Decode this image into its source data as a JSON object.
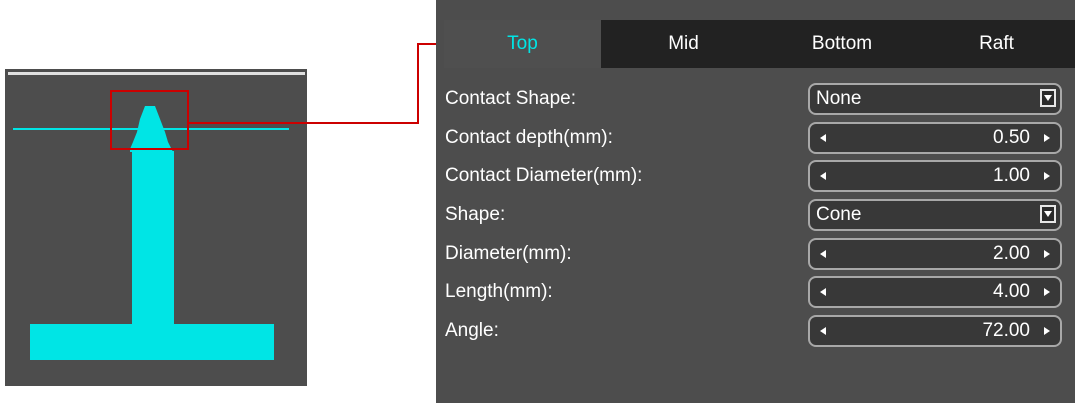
{
  "colors": {
    "panel_bg": "#4d4d4d",
    "tabbar_bg": "#222222",
    "active_tab_text": "#00e5e5",
    "support_fill": "#00e5e5",
    "callout_red": "#cc0000"
  },
  "tabs": [
    {
      "label": "Top",
      "active": true
    },
    {
      "label": "Mid",
      "active": false
    },
    {
      "label": "Bottom",
      "active": false
    },
    {
      "label": "Raft",
      "active": false
    }
  ],
  "settings": [
    {
      "label": "Contact Shape:",
      "control": "combo",
      "value": "None",
      "icon": "dropdown-arrow-icon"
    },
    {
      "label": "Contact depth(mm):",
      "control": "spinner",
      "value": "0.50"
    },
    {
      "label": "Contact Diameter(mm):",
      "control": "spinner",
      "value": "1.00"
    },
    {
      "label": "Shape:",
      "control": "combo",
      "value": "Cone",
      "icon": "dropdown-arrow-icon"
    },
    {
      "label": "Diameter(mm):",
      "control": "spinner",
      "value": "2.00"
    },
    {
      "label": "Length(mm):",
      "control": "spinner",
      "value": "4.00"
    },
    {
      "label": "Angle:",
      "control": "spinner",
      "value": "72.00"
    }
  ]
}
